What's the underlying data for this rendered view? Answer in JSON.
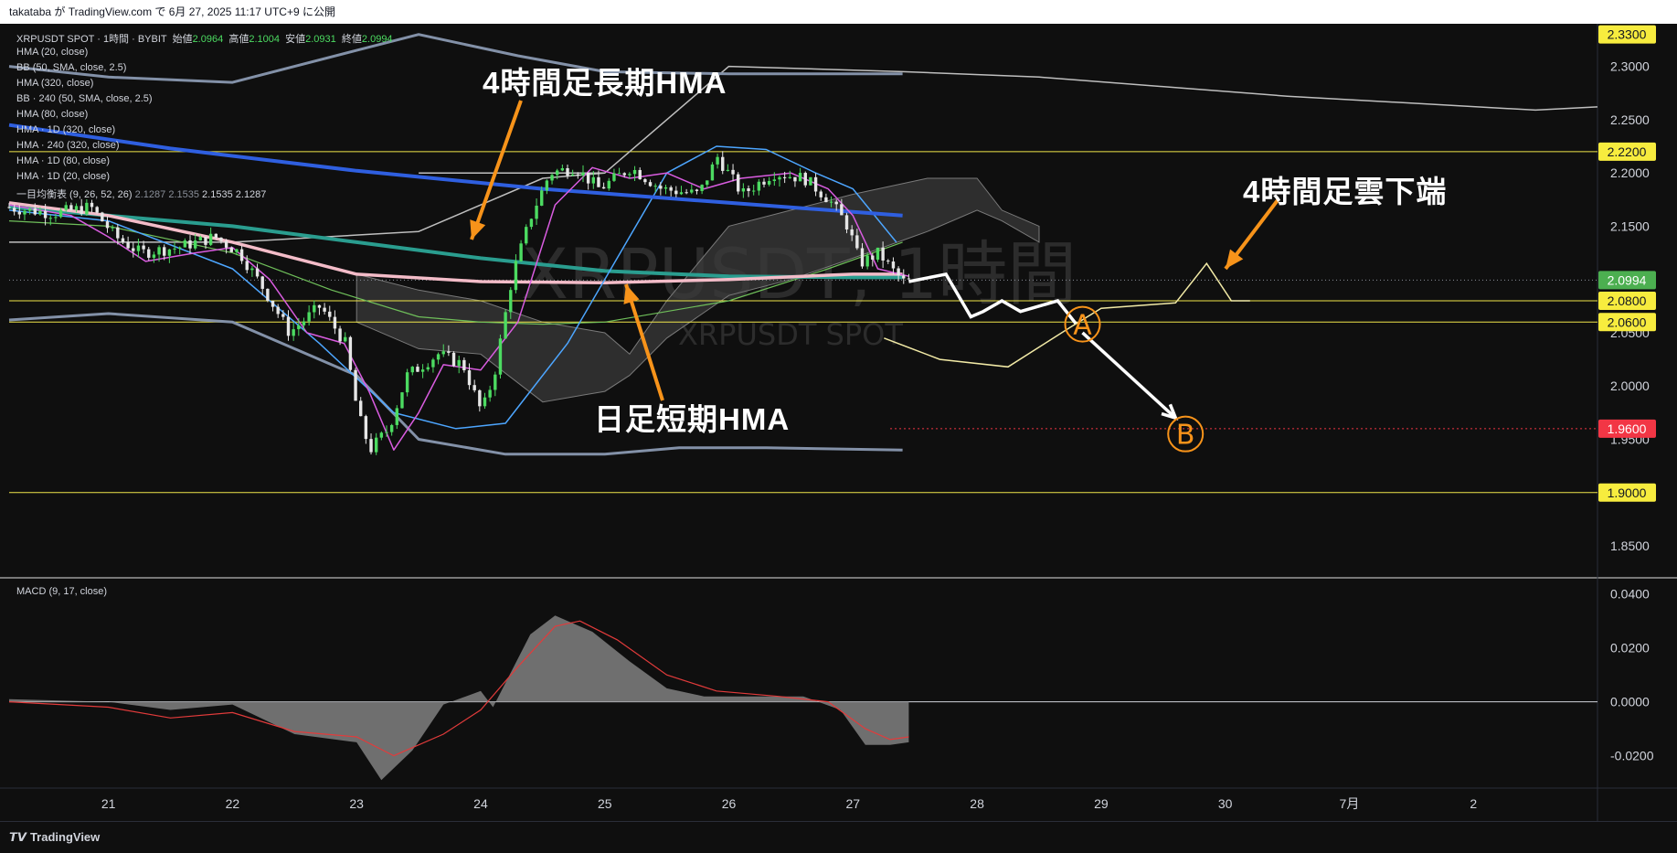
{
  "header": {
    "publish_line": "takataba が TradingView.com で 6月 27, 2025 11:17 UTC+9 に公開"
  },
  "legend": {
    "symbol_line": "XRPUSDT SPOT · 1時間 · BYBIT",
    "ohlc": [
      {
        "label": "始値",
        "value": "2.0964"
      },
      {
        "label": "高値",
        "value": "2.1004"
      },
      {
        "label": "安値",
        "value": "2.0931"
      },
      {
        "label": "終値",
        "value": "2.0994"
      }
    ],
    "indicators": [
      "HMA (20, close)",
      "BB (50, SMA, close, 2.5)",
      "HMA (320, close)",
      "BB · 240 (50, SMA, close, 2.5)",
      "HMA (80, close)",
      "HMA · 1D (320, close)",
      "HMA · 240 (320, close)",
      "HMA · 1D (80, close)",
      "HMA · 1D (20, close)"
    ],
    "ichimoku_label": "一目均衡表 (9, 26, 52, 26)",
    "ichimoku_values": [
      "2.1287",
      "2.1535",
      "2.1535",
      "2.1287"
    ],
    "macd_label": "MACD (9, 17, close)"
  },
  "watermark": {
    "big": "XRPUSDT, 1時間",
    "small": "XRPUSDT SPOT"
  },
  "annotations": {
    "hma_4h_long": "4時間足長期HMA",
    "hma_daily_short": "日足短期HMA",
    "cloud_4h_bottom": "4時間足雲下端",
    "wave_a": "A",
    "wave_b": "B"
  },
  "footer": {
    "brand": "TradingView"
  },
  "colors": {
    "background": "#0f0f0f",
    "up": "#4cdb61",
    "down": "#e6e6e6",
    "level_line": "#f0e64a",
    "support_line": "#f23645",
    "arrow": "#f7931a",
    "hma_4h_long": "#2f5fe0",
    "hma_daily_short": "#f3bcc8",
    "hma_teal": "#2a9d8f"
  },
  "chart_data": {
    "type": "candlestick",
    "price_axis": {
      "ylim": [
        1.82,
        2.34
      ],
      "ticks": [
        "2.3000",
        "2.2500",
        "2.2000",
        "2.1500",
        "2.0500",
        "2.0000",
        "1.9500",
        "1.8500"
      ],
      "badges": [
        {
          "value": "2.3300",
          "kind": "level"
        },
        {
          "value": "2.2200",
          "kind": "level"
        },
        {
          "value": "2.0994",
          "kind": "last"
        },
        {
          "value": "2.0800",
          "kind": "level"
        },
        {
          "value": "2.0600",
          "kind": "level"
        },
        {
          "value": "1.9600",
          "kind": "support"
        },
        {
          "value": "1.9000",
          "kind": "level"
        }
      ]
    },
    "horizontal_levels": [
      2.22,
      2.08,
      2.06,
      1.9
    ],
    "support_dotted": 1.96,
    "last_price": 2.0994,
    "time_axis": {
      "range": [
        20.2,
        33.0
      ],
      "ticks": [
        {
          "label": "21",
          "t": 21
        },
        {
          "label": "22",
          "t": 22
        },
        {
          "label": "23",
          "t": 23
        },
        {
          "label": "24",
          "t": 24
        },
        {
          "label": "25",
          "t": 25
        },
        {
          "label": "26",
          "t": 26
        },
        {
          "label": "27",
          "t": 27
        },
        {
          "label": "28",
          "t": 28
        },
        {
          "label": "29",
          "t": 29
        },
        {
          "label": "30",
          "t": 30
        },
        {
          "label": "7月",
          "t": 31
        },
        {
          "label": "2",
          "t": 32
        }
      ]
    },
    "price_path": [
      [
        20.2,
        2.168
      ],
      [
        20.6,
        2.162
      ],
      [
        20.9,
        2.168
      ],
      [
        21.1,
        2.14
      ],
      [
        21.3,
        2.125
      ],
      [
        21.6,
        2.13
      ],
      [
        21.9,
        2.14
      ],
      [
        22.1,
        2.125
      ],
      [
        22.3,
        2.09
      ],
      [
        22.5,
        2.05
      ],
      [
        22.75,
        2.075
      ],
      [
        22.95,
        2.04
      ],
      [
        23.05,
        1.975
      ],
      [
        23.15,
        1.94
      ],
      [
        23.3,
        1.96
      ],
      [
        23.45,
        2.01
      ],
      [
        23.7,
        2.03
      ],
      [
        23.9,
        2.02
      ],
      [
        24.05,
        1.975
      ],
      [
        24.15,
        2.01
      ],
      [
        24.3,
        2.105
      ],
      [
        24.45,
        2.16
      ],
      [
        24.6,
        2.2
      ],
      [
        24.8,
        2.205
      ],
      [
        25.0,
        2.185
      ],
      [
        25.25,
        2.205
      ],
      [
        25.5,
        2.185
      ],
      [
        25.8,
        2.18
      ],
      [
        25.95,
        2.215
      ],
      [
        26.15,
        2.18
      ],
      [
        26.4,
        2.2
      ],
      [
        26.65,
        2.195
      ],
      [
        26.85,
        2.175
      ],
      [
        27.0,
        2.15
      ],
      [
        27.1,
        2.115
      ],
      [
        27.25,
        2.125
      ],
      [
        27.35,
        2.11
      ],
      [
        27.45,
        2.098
      ]
    ],
    "overlays": {
      "hma_4h_long": [
        [
          20.2,
          2.245
        ],
        [
          21.5,
          2.223
        ],
        [
          23.0,
          2.202
        ],
        [
          24.5,
          2.185
        ],
        [
          26.0,
          2.172
        ],
        [
          27.4,
          2.16
        ]
      ],
      "hma_daily_short": [
        [
          20.2,
          2.172
        ],
        [
          21.0,
          2.16
        ],
        [
          22.0,
          2.135
        ],
        [
          23.0,
          2.105
        ],
        [
          24.0,
          2.098
        ],
        [
          25.0,
          2.097
        ],
        [
          26.0,
          2.1
        ],
        [
          27.0,
          2.105
        ],
        [
          27.4,
          2.105
        ]
      ],
      "hma_teal": [
        [
          20.2,
          2.168
        ],
        [
          21.0,
          2.16
        ],
        [
          22.0,
          2.15
        ],
        [
          23.0,
          2.135
        ],
        [
          24.0,
          2.12
        ],
        [
          25.0,
          2.108
        ],
        [
          26.0,
          2.103
        ],
        [
          27.0,
          2.102
        ],
        [
          27.4,
          2.102
        ]
      ],
      "bb_upper": [
        [
          20.2,
          2.3
        ],
        [
          21.0,
          2.29
        ],
        [
          22.0,
          2.285
        ],
        [
          23.0,
          2.315
        ],
        [
          23.5,
          2.33
        ],
        [
          24.3,
          2.31
        ],
        [
          25.0,
          2.295
        ],
        [
          26.0,
          2.293
        ],
        [
          27.4,
          2.293
        ]
      ],
      "bb_lower": [
        [
          20.2,
          2.062
        ],
        [
          21.0,
          2.068
        ],
        [
          22.0,
          2.06
        ],
        [
          23.0,
          2.01
        ],
        [
          23.5,
          1.95
        ],
        [
          24.2,
          1.936
        ],
        [
          25.0,
          1.936
        ],
        [
          25.6,
          1.942
        ],
        [
          26.3,
          1.942
        ],
        [
          27.4,
          1.94
        ]
      ],
      "bb4h_upper": [
        [
          23.5,
          2.2
        ],
        [
          25.0,
          2.2
        ],
        [
          26.0,
          2.3
        ],
        [
          27.4,
          2.295
        ],
        [
          28.5,
          2.29
        ],
        [
          30.5,
          2.272
        ],
        [
          32.5,
          2.259
        ],
        [
          33.0,
          2.262
        ]
      ],
      "bb4h_lower": [
        [
          20.2,
          2.135
        ],
        [
          22.0,
          2.135
        ],
        [
          23.5,
          2.145
        ],
        [
          24.5,
          2.195
        ],
        [
          25.0,
          2.2
        ]
      ],
      "hma_blue": [
        [
          20.2,
          2.165
        ],
        [
          21.0,
          2.155
        ],
        [
          22.0,
          2.11
        ],
        [
          22.7,
          2.04
        ],
        [
          23.3,
          1.975
        ],
        [
          23.8,
          1.96
        ],
        [
          24.2,
          1.965
        ],
        [
          24.7,
          2.04
        ],
        [
          25.1,
          2.12
        ],
        [
          25.5,
          2.2
        ],
        [
          25.9,
          2.225
        ],
        [
          26.3,
          2.222
        ],
        [
          26.7,
          2.2
        ],
        [
          27.0,
          2.185
        ],
        [
          27.35,
          2.135
        ]
      ],
      "hma_green": [
        [
          20.2,
          2.155
        ],
        [
          21.0,
          2.15
        ],
        [
          22.0,
          2.125
        ],
        [
          22.8,
          2.09
        ],
        [
          23.5,
          2.065
        ],
        [
          24.0,
          2.06
        ],
        [
          24.5,
          2.058
        ],
        [
          25.0,
          2.06
        ],
        [
          26.0,
          2.08
        ],
        [
          26.8,
          2.11
        ],
        [
          27.4,
          2.135
        ]
      ],
      "hma_magenta": [
        [
          20.2,
          2.17
        ],
        [
          20.7,
          2.16
        ],
        [
          21.0,
          2.14
        ],
        [
          21.3,
          2.117
        ],
        [
          21.7,
          2.125
        ],
        [
          22.0,
          2.13
        ],
        [
          22.3,
          2.1
        ],
        [
          22.6,
          2.05
        ],
        [
          22.9,
          2.04
        ],
        [
          23.1,
          1.995
        ],
        [
          23.3,
          1.94
        ],
        [
          23.5,
          1.975
        ],
        [
          23.7,
          2.02
        ],
        [
          24.0,
          2.015
        ],
        [
          24.3,
          2.06
        ],
        [
          24.6,
          2.17
        ],
        [
          24.9,
          2.205
        ],
        [
          25.2,
          2.195
        ],
        [
          25.5,
          2.2
        ],
        [
          25.8,
          2.185
        ],
        [
          26.1,
          2.195
        ],
        [
          26.5,
          2.2
        ],
        [
          26.8,
          2.185
        ],
        [
          27.0,
          2.16
        ],
        [
          27.2,
          2.11
        ],
        [
          27.45,
          2.103
        ]
      ],
      "cloud_upper": [
        [
          23.0,
          2.105
        ],
        [
          23.5,
          2.09
        ],
        [
          24.0,
          2.08
        ],
        [
          24.5,
          2.06
        ],
        [
          25.0,
          2.05
        ],
        [
          25.2,
          2.03
        ],
        [
          25.5,
          2.08
        ],
        [
          26.0,
          2.15
        ],
        [
          26.5,
          2.165
        ],
        [
          27.0,
          2.18
        ],
        [
          27.6,
          2.195
        ],
        [
          28.0,
          2.195
        ],
        [
          28.2,
          2.165
        ],
        [
          28.5,
          2.15
        ]
      ],
      "cloud_lower": [
        [
          23.0,
          2.06
        ],
        [
          23.5,
          2.035
        ],
        [
          24.0,
          2.03
        ],
        [
          24.5,
          1.985
        ],
        [
          25.0,
          1.995
        ],
        [
          25.2,
          2.01
        ],
        [
          25.5,
          2.045
        ],
        [
          26.0,
          2.085
        ],
        [
          26.5,
          2.1
        ],
        [
          27.0,
          2.12
        ],
        [
          27.6,
          2.145
        ],
        [
          28.0,
          2.165
        ],
        [
          28.2,
          2.155
        ],
        [
          28.5,
          2.135
        ]
      ]
    },
    "forecast_path": [
      [
        27.45,
        2.098
      ],
      [
        27.75,
        2.105
      ],
      [
        27.95,
        2.065
      ],
      [
        28.05,
        2.07
      ],
      [
        28.2,
        2.08
      ],
      [
        28.35,
        2.07
      ],
      [
        28.65,
        2.08
      ],
      [
        28.8,
        2.058
      ]
    ],
    "forecast_arrow": [
      [
        28.85,
        2.05
      ],
      [
        29.6,
        1.97
      ]
    ],
    "cloud_4h_bottom_line": [
      [
        27.25,
        2.045
      ],
      [
        27.7,
        2.025
      ],
      [
        28.25,
        2.018
      ],
      [
        28.75,
        2.055
      ],
      [
        29.0,
        2.073
      ],
      [
        29.6,
        2.078
      ],
      [
        29.85,
        2.115
      ],
      [
        30.05,
        2.08
      ],
      [
        30.2,
        2.08
      ]
    ],
    "macd": {
      "ylim": [
        -0.032,
        0.046
      ],
      "ticks": [
        "0.0400",
        "0.0200",
        "0.0000",
        "-0.0200"
      ],
      "series": [
        {
          "name": "MACD (9, 17, close)",
          "values": [
            [
              20.2,
              0.001
            ],
            [
              21.0,
              0.0
            ],
            [
              21.5,
              -0.003
            ],
            [
              22.0,
              -0.001
            ],
            [
              22.5,
              -0.012
            ],
            [
              23.0,
              -0.015
            ],
            [
              23.2,
              -0.029
            ],
            [
              23.45,
              -0.018
            ],
            [
              23.7,
              -0.001
            ],
            [
              24.0,
              0.004
            ],
            [
              24.1,
              -0.002
            ],
            [
              24.4,
              0.025
            ],
            [
              24.6,
              0.032
            ],
            [
              24.9,
              0.026
            ],
            [
              25.2,
              0.015
            ],
            [
              25.5,
              0.005
            ],
            [
              25.8,
              0.002
            ],
            [
              26.2,
              0.002
            ],
            [
              26.6,
              0.002
            ],
            [
              26.9,
              -0.003
            ],
            [
              27.1,
              -0.016
            ],
            [
              27.3,
              -0.016
            ],
            [
              27.45,
              -0.015
            ]
          ]
        },
        {
          "name": "signal",
          "values": [
            [
              20.2,
              0.0
            ],
            [
              21.0,
              -0.002
            ],
            [
              21.5,
              -0.006
            ],
            [
              22.0,
              -0.004
            ],
            [
              22.5,
              -0.011
            ],
            [
              23.0,
              -0.013
            ],
            [
              23.3,
              -0.02
            ],
            [
              23.7,
              -0.012
            ],
            [
              24.0,
              -0.003
            ],
            [
              24.3,
              0.013
            ],
            [
              24.6,
              0.028
            ],
            [
              24.8,
              0.03
            ],
            [
              25.1,
              0.023
            ],
            [
              25.5,
              0.01
            ],
            [
              25.9,
              0.004
            ],
            [
              26.4,
              0.002
            ],
            [
              26.8,
              0.0
            ],
            [
              27.1,
              -0.01
            ],
            [
              27.3,
              -0.014
            ],
            [
              27.45,
              -0.013
            ]
          ]
        }
      ]
    }
  }
}
